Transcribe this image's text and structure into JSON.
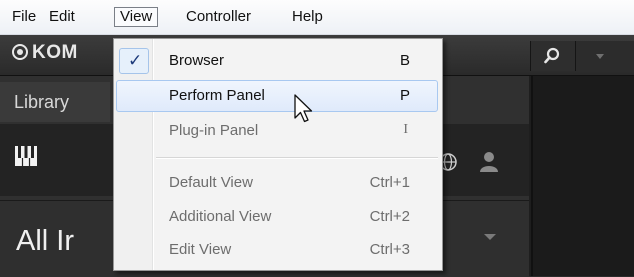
{
  "menubar": {
    "items": [
      {
        "label": "File"
      },
      {
        "label": "Edit"
      },
      {
        "label": "View"
      },
      {
        "label": "Controller"
      },
      {
        "label": "Help"
      }
    ]
  },
  "app": {
    "logo_text": "KOM",
    "library_tab": "Library",
    "all_instruments": "All Ir"
  },
  "view_menu": {
    "items": [
      {
        "label": "Browser",
        "shortcut": "B",
        "checked": true,
        "enabled": true
      },
      {
        "label": "Perform Panel",
        "shortcut": "P",
        "checked": false,
        "enabled": true,
        "highlighted": true
      },
      {
        "label": "Plug-in Panel",
        "shortcut": "I",
        "checked": false,
        "enabled": false
      },
      {
        "label": "Default View",
        "shortcut": "Ctrl+1",
        "checked": false,
        "enabled": false
      },
      {
        "label": "Additional View",
        "shortcut": "Ctrl+2",
        "checked": false,
        "enabled": false
      },
      {
        "label": "Edit View",
        "shortcut": "Ctrl+3",
        "checked": false,
        "enabled": false
      }
    ],
    "check_glyph": "✓"
  },
  "colors": {
    "menu_bg": "#f3f3f3",
    "highlight_border": "#a8c8f0",
    "app_dark": "#1e1e1e",
    "check_color": "#1d3a7a"
  },
  "icons": [
    "search-icon",
    "chevron-down-icon",
    "piano-keys-icon",
    "globe-icon",
    "user-icon",
    "mouse-pointer-icon"
  ]
}
